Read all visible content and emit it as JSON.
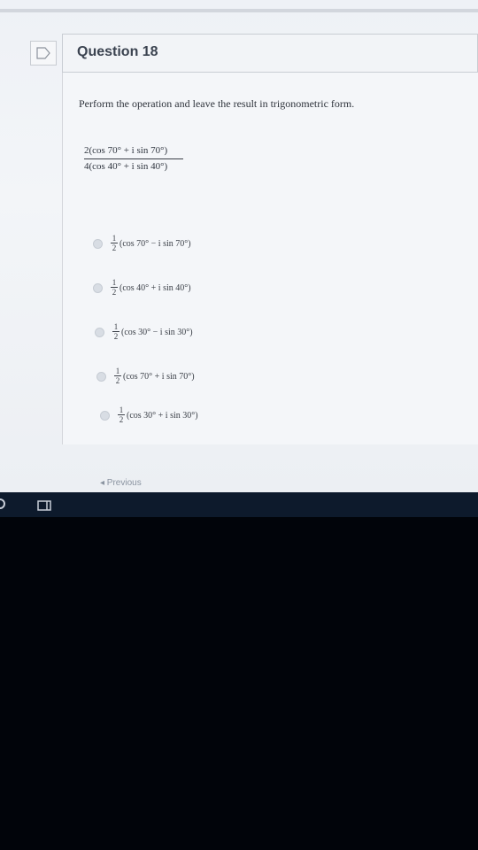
{
  "question": {
    "title": "Question 18",
    "prompt": "Perform the operation and leave the result in trigonometric form.",
    "expression": {
      "numerator": "2(cos 70° + i sin 70°)",
      "denominator": "4(cos 40° + i sin 40°)"
    },
    "options": [
      {
        "coef_num": "1",
        "coef_den": "2",
        "text": "(cos 70° − i sin 70°)"
      },
      {
        "coef_num": "1",
        "coef_den": "2",
        "text": "(cos 40° + i sin 40°)"
      },
      {
        "coef_num": "1",
        "coef_den": "2",
        "text": "(cos 30° − i sin 30°)"
      },
      {
        "coef_num": "1",
        "coef_den": "2",
        "text": "(cos 70° + i sin 70°)"
      },
      {
        "coef_num": "1",
        "coef_den": "2",
        "text": "(cos 30° + i sin 30°)"
      }
    ]
  },
  "navigation": {
    "previous": "◂ Previous"
  },
  "icons": {
    "flag": "flag-icon",
    "taskbar_start": "circle-icon",
    "taskbar_view": "task-view-icon"
  }
}
